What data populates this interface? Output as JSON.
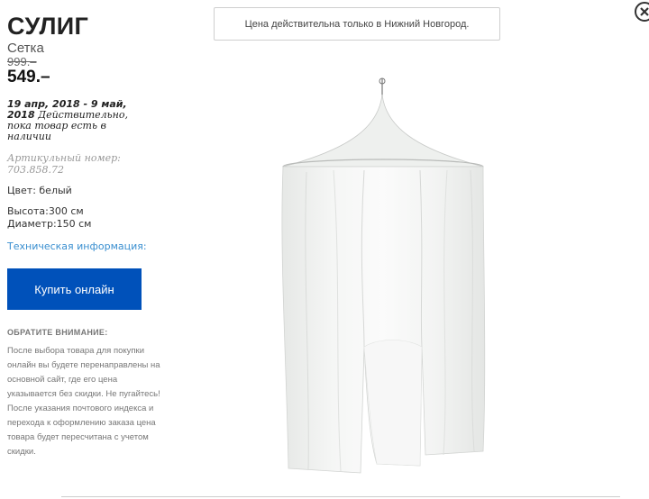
{
  "product": {
    "name": "СУЛИГ",
    "type": "Сетка",
    "old_price": "999.–",
    "price": "549.–",
    "validity_dates": "19 апр, 2018 - 9 май, 2018",
    "validity_text": " Действительно, пока товар есть в наличии",
    "article_label": "Артикульный номер:",
    "article_number": "703.858.72",
    "color": "Цвет: белый",
    "height": "Высота:300 см",
    "diameter": "Диаметр:150 см",
    "tech_link": "Техническая информация:"
  },
  "buy_button": {
    "label": "Купить онлайн",
    "color": "#0051ba"
  },
  "note": {
    "heading": "ОБРАТИТЕ ВНИМАНИЕ:",
    "body": "После выбора товара для покупки онлайн вы будете перенаправлены на основной сайт, где его цена указывается без скидки. Не пугайтесь! После указания почтового индекса и перехода к оформлению заказа цена товара будет пересчитана с учетом скидки."
  },
  "banner": {
    "text": "Цена действительна только в Нижний Новгород."
  },
  "icons": {
    "close": "close-icon",
    "product": "mosquito-net-canopy-image"
  },
  "colors": {
    "link": "#3a8fd0",
    "button": "#0051ba"
  }
}
